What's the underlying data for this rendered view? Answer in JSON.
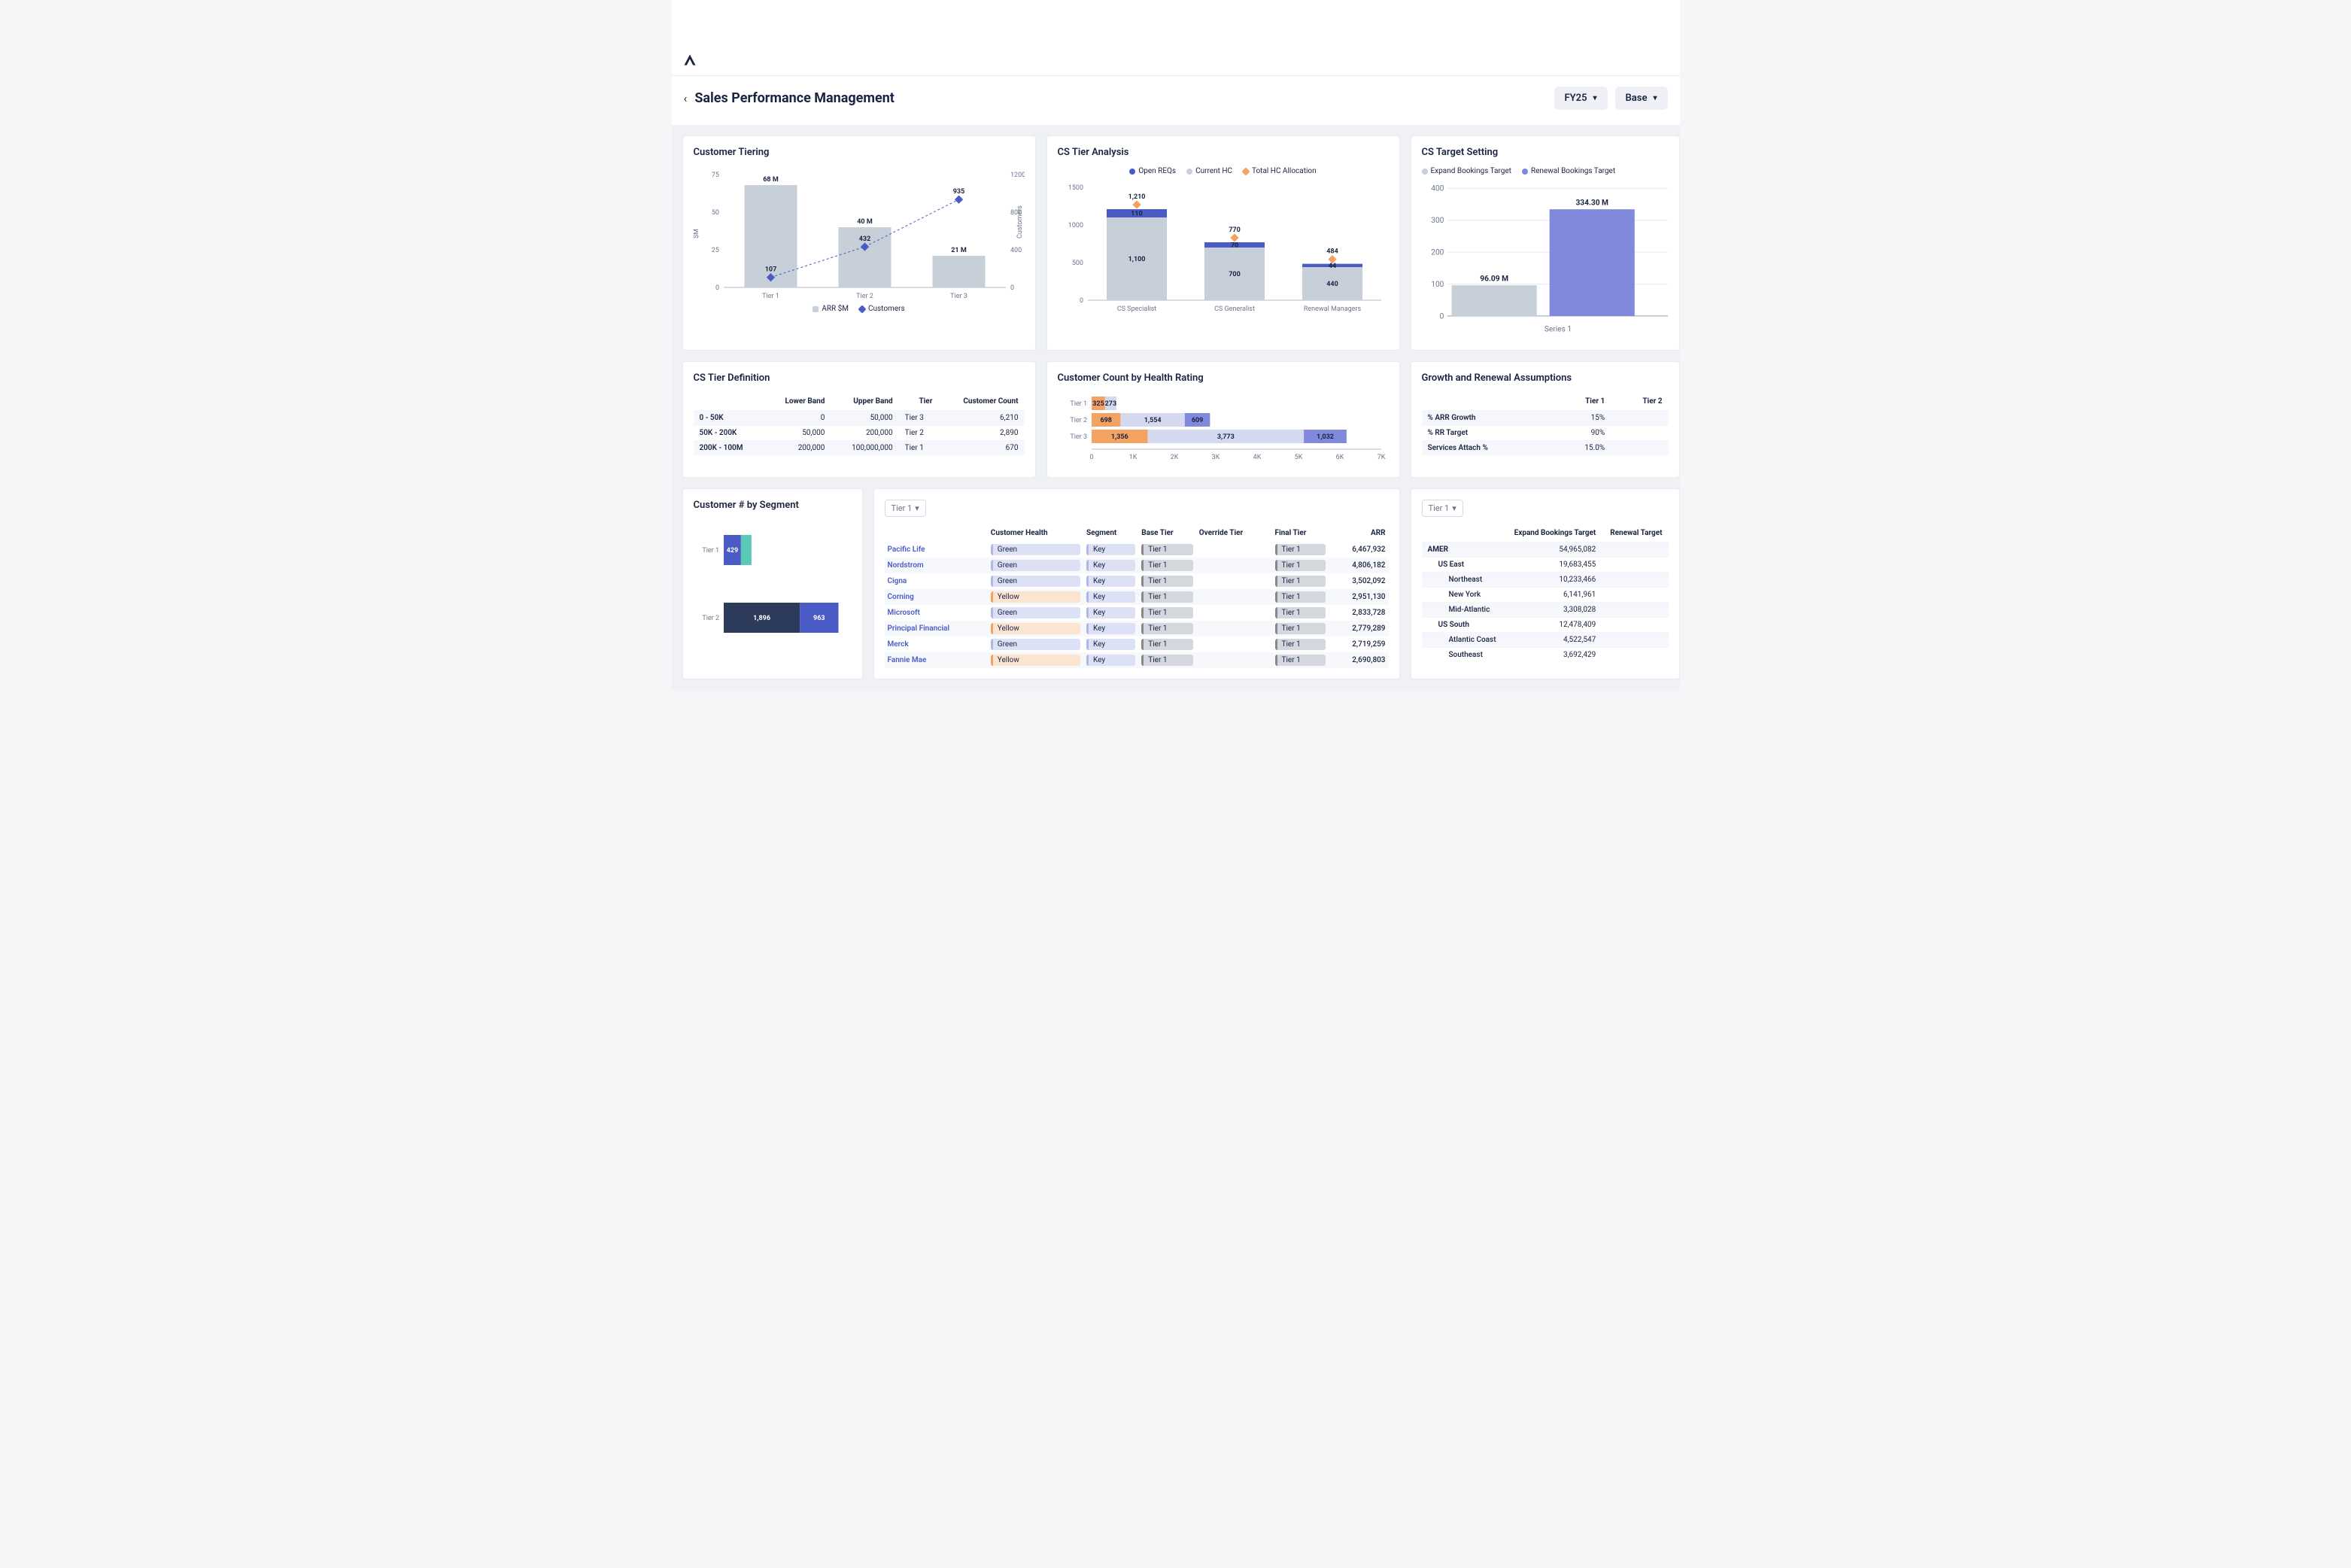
{
  "header": {
    "page_title": "Sales Performance Management"
  },
  "filters": {
    "period": "FY25",
    "scenario": "Base"
  },
  "cards": {
    "tiering": {
      "title": "Customer Tiering"
    },
    "analysis": {
      "title": "CS Tier Analysis"
    },
    "target": {
      "title": "CS Target Setting"
    },
    "definition": {
      "title": "CS Tier Definition"
    },
    "health": {
      "title": "Customer Count by Health Rating"
    },
    "assumptions": {
      "title": "Growth and Renewal Assumptions"
    },
    "segment": {
      "title": "Customer # by Segment"
    }
  },
  "chart_data": [
    {
      "id": "customer_tiering",
      "type": "bar+line",
      "categories": [
        "Tier 1",
        "Tier 2",
        "Tier 3"
      ],
      "series": [
        {
          "name": "ARR $M",
          "type": "bar",
          "values": [
            68,
            40,
            21
          ],
          "labels": [
            "68 M",
            "40 M",
            "21 M"
          ]
        },
        {
          "name": "Customers",
          "type": "line",
          "values": [
            107,
            432,
            935
          ]
        }
      ],
      "ylabel_left": "$M",
      "ylim_left": [
        0,
        75
      ],
      "yticks_left": [
        0,
        25,
        50,
        75
      ],
      "ylabel_right": "Customers",
      "ylim_right": [
        0,
        1200
      ],
      "yticks_right": [
        0,
        400,
        800,
        1200
      ]
    },
    {
      "id": "cs_tier_analysis",
      "type": "stacked-bar",
      "categories": [
        "CS Specialist",
        "CS Generalist",
        "Renewal Managers"
      ],
      "series": [
        {
          "name": "Open REQs",
          "color": "#4a5bc5",
          "values": [
            110,
            70,
            44
          ]
        },
        {
          "name": "Current HC",
          "color": "#c7cfd8",
          "values": [
            1100,
            700,
            440
          ]
        },
        {
          "name": "Total HC Allocation",
          "color": "#f4a261",
          "type": "marker",
          "values": [
            1210,
            770,
            484
          ]
        }
      ],
      "ylim": [
        0,
        1500
      ],
      "yticks": [
        0,
        500,
        1000,
        1500
      ]
    },
    {
      "id": "cs_target_setting",
      "type": "bar",
      "categories": [
        "Series 1"
      ],
      "series": [
        {
          "name": "Expand Bookings Target",
          "color": "#c7cfd8",
          "values": [
            96.09
          ],
          "labels": [
            "96.09 M"
          ]
        },
        {
          "name": "Renewal Bookings Target",
          "color": "#8089dc",
          "values": [
            334.3
          ],
          "labels": [
            "334.30 M"
          ]
        }
      ],
      "ylim": [
        0,
        400
      ],
      "yticks": [
        0,
        100,
        200,
        300,
        400
      ]
    },
    {
      "id": "customer_count_health",
      "type": "stacked-hbar",
      "categories": [
        "Tier 1",
        "Tier 2",
        "Tier 3"
      ],
      "series": [
        {
          "name": "Orange",
          "color": "#f4a261",
          "values": [
            325,
            698,
            1356
          ]
        },
        {
          "name": "Lavender",
          "color": "#d5d9f0",
          "values": [
            273,
            1554,
            3773
          ]
        },
        {
          "name": "Purple",
          "color": "#8089dc",
          "values": [
            0,
            609,
            1032
          ]
        }
      ],
      "xlim": [
        0,
        7000
      ],
      "xticks": [
        0,
        1000,
        2000,
        3000,
        4000,
        5000,
        6000,
        7000
      ],
      "xtick_labels": [
        "0",
        "1K",
        "2K",
        "3K",
        "4K",
        "5K",
        "6K",
        "7K"
      ]
    },
    {
      "id": "customer_by_segment",
      "type": "stacked-hbar",
      "categories": [
        "Tier 1",
        "Tier 2"
      ],
      "series": [
        {
          "name": "dark",
          "color": "#2c3a5c",
          "values": [
            0,
            1896
          ]
        },
        {
          "name": "blue",
          "color": "#4a5bc5",
          "values": [
            429,
            963
          ]
        },
        {
          "name": "teal",
          "color": "#5cc9b6",
          "values": [
            20,
            0
          ]
        }
      ]
    }
  ],
  "tier_definition": {
    "headers": [
      "",
      "Lower Band",
      "Upper Band",
      "Tier",
      "Customer Count"
    ],
    "rows": [
      {
        "range": "0 - 50K",
        "lower": "0",
        "upper": "50,000",
        "tier": "Tier 3",
        "count": "6,210"
      },
      {
        "range": "50K - 200K",
        "lower": "50,000",
        "upper": "200,000",
        "tier": "Tier 2",
        "count": "2,890"
      },
      {
        "range": "200K - 100M",
        "lower": "200,000",
        "upper": "100,000,000",
        "tier": "Tier 1",
        "count": "670"
      }
    ]
  },
  "assumptions": {
    "headers": [
      "",
      "Tier 1",
      "Tier 2"
    ],
    "rows": [
      {
        "label": "% ARR Growth",
        "t1": "15%",
        "t2": ""
      },
      {
        "label": "% RR Target",
        "t1": "90%",
        "t2": ""
      },
      {
        "label": "Services Attach %",
        "t1": "15.0%",
        "t2": ""
      }
    ]
  },
  "customer_table": {
    "selector": "Tier 1",
    "headers": [
      "",
      "Customer Health",
      "Segment",
      "Base Tier",
      "Override Tier",
      "Final Tier",
      "ARR"
    ],
    "rows": [
      {
        "name": "Pacific Life",
        "health": "Green",
        "segment": "Key",
        "base": "Tier 1",
        "override": "",
        "final": "Tier 1",
        "arr": "6,467,932"
      },
      {
        "name": "Nordstrom",
        "health": "Green",
        "segment": "Key",
        "base": "Tier 1",
        "override": "",
        "final": "Tier 1",
        "arr": "4,806,182"
      },
      {
        "name": "Cigna",
        "health": "Green",
        "segment": "Key",
        "base": "Tier 1",
        "override": "",
        "final": "Tier 1",
        "arr": "3,502,092"
      },
      {
        "name": "Corning",
        "health": "Yellow",
        "segment": "Key",
        "base": "Tier 1",
        "override": "",
        "final": "Tier 1",
        "arr": "2,951,130"
      },
      {
        "name": "Microsoft",
        "health": "Green",
        "segment": "Key",
        "base": "Tier 1",
        "override": "",
        "final": "Tier 1",
        "arr": "2,833,728"
      },
      {
        "name": "Principal Financial",
        "health": "Yellow",
        "segment": "Key",
        "base": "Tier 1",
        "override": "",
        "final": "Tier 1",
        "arr": "2,779,289"
      },
      {
        "name": "Merck",
        "health": "Green",
        "segment": "Key",
        "base": "Tier 1",
        "override": "",
        "final": "Tier 1",
        "arr": "2,719,259"
      },
      {
        "name": "Fannie Mae",
        "health": "Yellow",
        "segment": "Key",
        "base": "Tier 1",
        "override": "",
        "final": "Tier 1",
        "arr": "2,690,803"
      }
    ]
  },
  "region_table": {
    "selector": "Tier 1",
    "headers": [
      "",
      "Expand Bookings Target",
      "Renewal Target"
    ],
    "rows": [
      {
        "label": "AMER",
        "indent": 0,
        "val": "54,965,082"
      },
      {
        "label": "US East",
        "indent": 1,
        "val": "19,683,455"
      },
      {
        "label": "Northeast",
        "indent": 2,
        "val": "10,233,466"
      },
      {
        "label": "New York",
        "indent": 2,
        "val": "6,141,961"
      },
      {
        "label": "Mid-Atlantic",
        "indent": 2,
        "val": "3,308,028"
      },
      {
        "label": "US South",
        "indent": 1,
        "val": "12,478,409"
      },
      {
        "label": "Atlantic Coast",
        "indent": 2,
        "val": "4,522,547"
      },
      {
        "label": "Southeast",
        "indent": 2,
        "val": "3,692,429"
      }
    ]
  }
}
